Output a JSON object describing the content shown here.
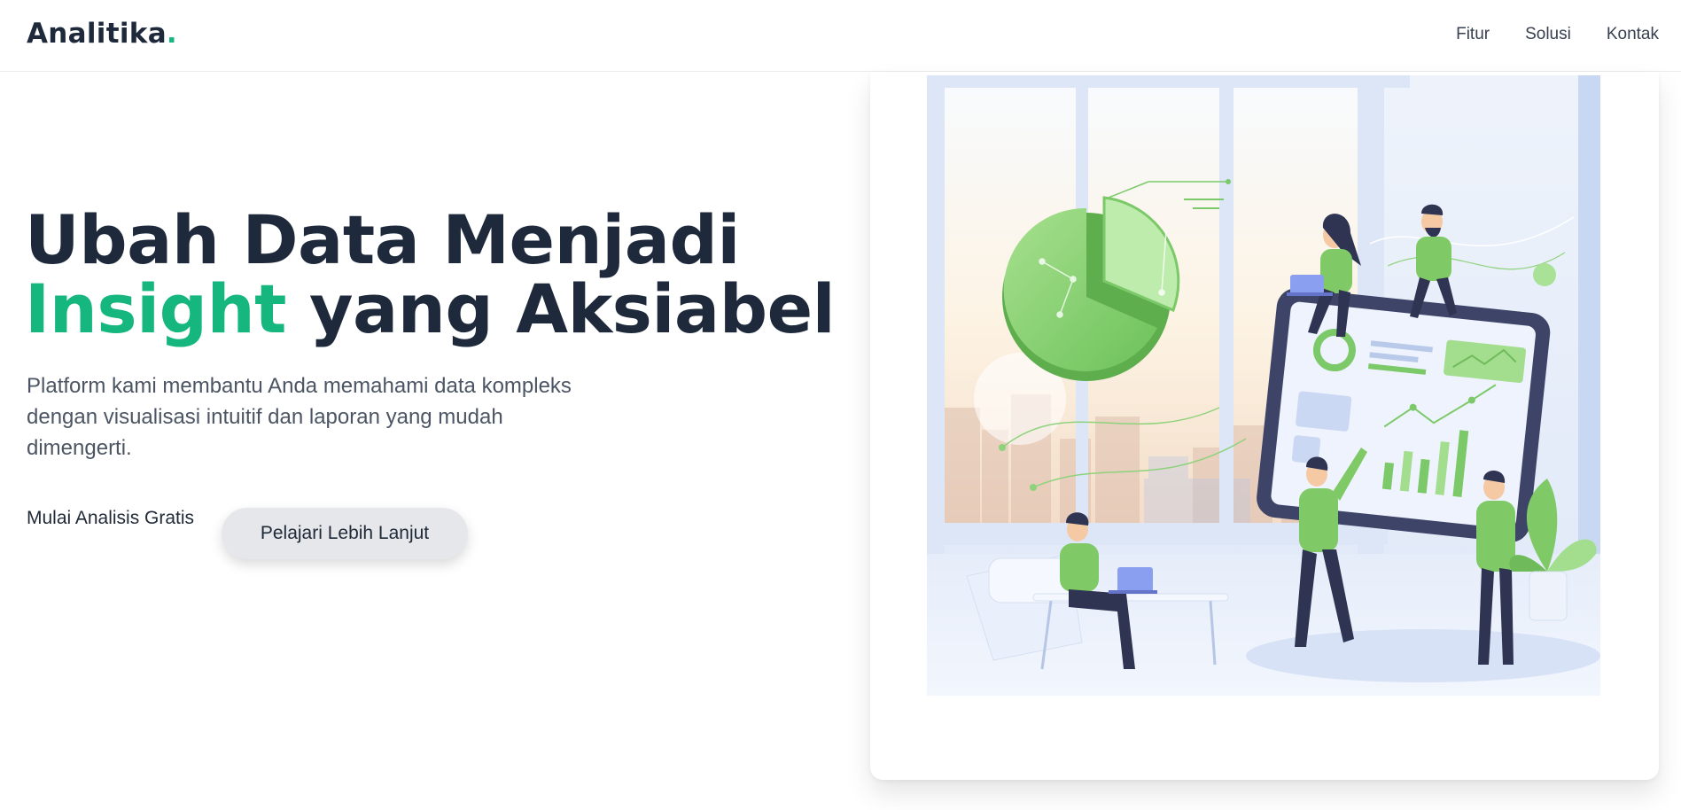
{
  "brand": {
    "name": "Analitika",
    "dot": "."
  },
  "nav": {
    "links": [
      "Fitur",
      "Solusi",
      "Kontak"
    ]
  },
  "hero": {
    "title_line1": "Ubah Data Menjadi",
    "title_accent": "Insight",
    "title_rest": " yang Aksiabel",
    "description": "Platform kami membantu Anda memahami data kompleks dengan visualisasi intuitif dan laporan yang mudah dimengerti.",
    "cta_primary": "Mulai Analisis Gratis",
    "cta_secondary": "Pelajari Lebih Lanjut"
  },
  "colors": {
    "accent": "#16b67f",
    "heading": "#1e2a3b",
    "button_bg": "#e5e7eb"
  },
  "illustration": {
    "subject": "team analyzing data dashboard illustration"
  }
}
